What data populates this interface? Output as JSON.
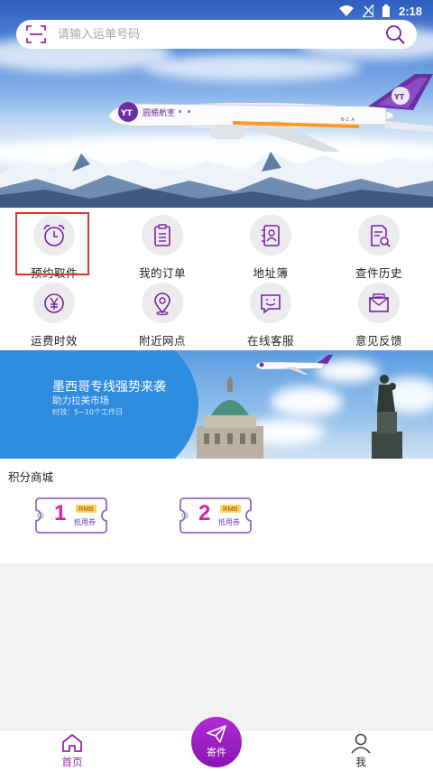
{
  "status_bar": {
    "time": "2:18"
  },
  "search": {
    "placeholder": "请输入运单号码"
  },
  "hero": {
    "airline_name": "圆通航空",
    "tail_number": "B-2..A"
  },
  "services": [
    {
      "label": "预约取件",
      "icon": "alarm-clock-icon"
    },
    {
      "label": "我的订单",
      "icon": "clipboard-icon"
    },
    {
      "label": "地址簿",
      "icon": "address-book-icon"
    },
    {
      "label": "查件历史",
      "icon": "document-search-icon"
    },
    {
      "label": "运费时效",
      "icon": "yen-coin-icon"
    },
    {
      "label": "附近网点",
      "icon": "location-pin-icon"
    },
    {
      "label": "在线客服",
      "icon": "chat-smile-icon"
    },
    {
      "label": "意见反馈",
      "icon": "mail-icon"
    }
  ],
  "banner": {
    "title": "墨西哥专线强势来袭",
    "subtitle": "助力拉美市场",
    "time_note": "时效：5~10个工作日"
  },
  "mall": {
    "title": "积分商城",
    "coupons": [
      {
        "amount": "1",
        "currency": "RMB",
        "label": "抵用券"
      },
      {
        "amount": "2",
        "currency": "RMB",
        "label": "抵用券"
      }
    ]
  },
  "nav": {
    "home": "首页",
    "send": "寄件",
    "me": "我"
  },
  "colors": {
    "accent": "#8a14b3",
    "icon_purple": "#7b1fa2",
    "coupon_pink": "#e51aa5",
    "highlight_red": "#e23232"
  }
}
